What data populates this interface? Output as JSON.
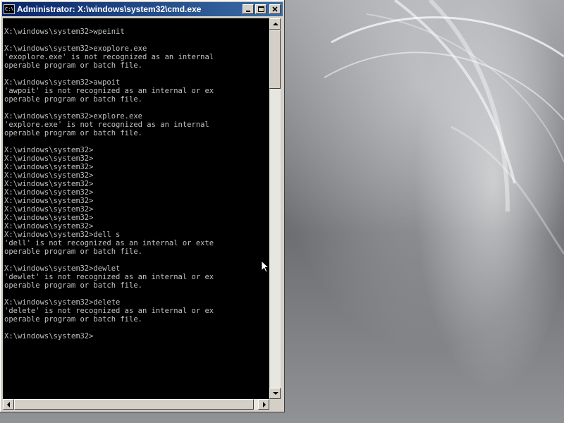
{
  "window": {
    "title": "Administrator: X:\\windows\\system32\\cmd.exe",
    "icon_text": "C:\\."
  },
  "console": {
    "lines": [
      "",
      "X:\\windows\\system32>wpeinit",
      "",
      "X:\\windows\\system32>exoplore.exe",
      "'exoplore.exe' is not recognized as an internal",
      "operable program or batch file.",
      "",
      "X:\\windows\\system32>awpoit",
      "'awpoit' is not recognized as an internal or ex",
      "operable program or batch file.",
      "",
      "X:\\windows\\system32>explore.exe",
      "'explore.exe' is not recognized as an internal",
      "operable program or batch file.",
      "",
      "X:\\windows\\system32>",
      "X:\\windows\\system32>",
      "X:\\windows\\system32>",
      "X:\\windows\\system32>",
      "X:\\windows\\system32>",
      "X:\\windows\\system32>",
      "X:\\windows\\system32>",
      "X:\\windows\\system32>",
      "X:\\windows\\system32>",
      "X:\\windows\\system32>",
      "X:\\windows\\system32>dell s",
      "'dell' is not recognized as an internal or exte",
      "operable program or batch file.",
      "",
      "X:\\windows\\system32>dewlet",
      "'dewlet' is not recognized as an internal or ex",
      "operable program or batch file.",
      "",
      "X:\\windows\\system32>delete",
      "'delete' is not recognized as an internal or ex",
      "operable program or batch file.",
      "",
      "X:\\windows\\system32>"
    ]
  },
  "colors": {
    "titlebar_start": "#0a246a",
    "titlebar_end": "#3a6ea5",
    "console_bg": "#000000",
    "console_fg": "#c0c0c0"
  },
  "icons": [
    "cmd-window-icon",
    "minimize-icon",
    "maximize-icon",
    "close-icon",
    "scroll-up-arrow-icon",
    "scroll-down-arrow-icon",
    "scroll-left-arrow-icon",
    "scroll-right-arrow-icon",
    "mouse-pointer-icon"
  ]
}
